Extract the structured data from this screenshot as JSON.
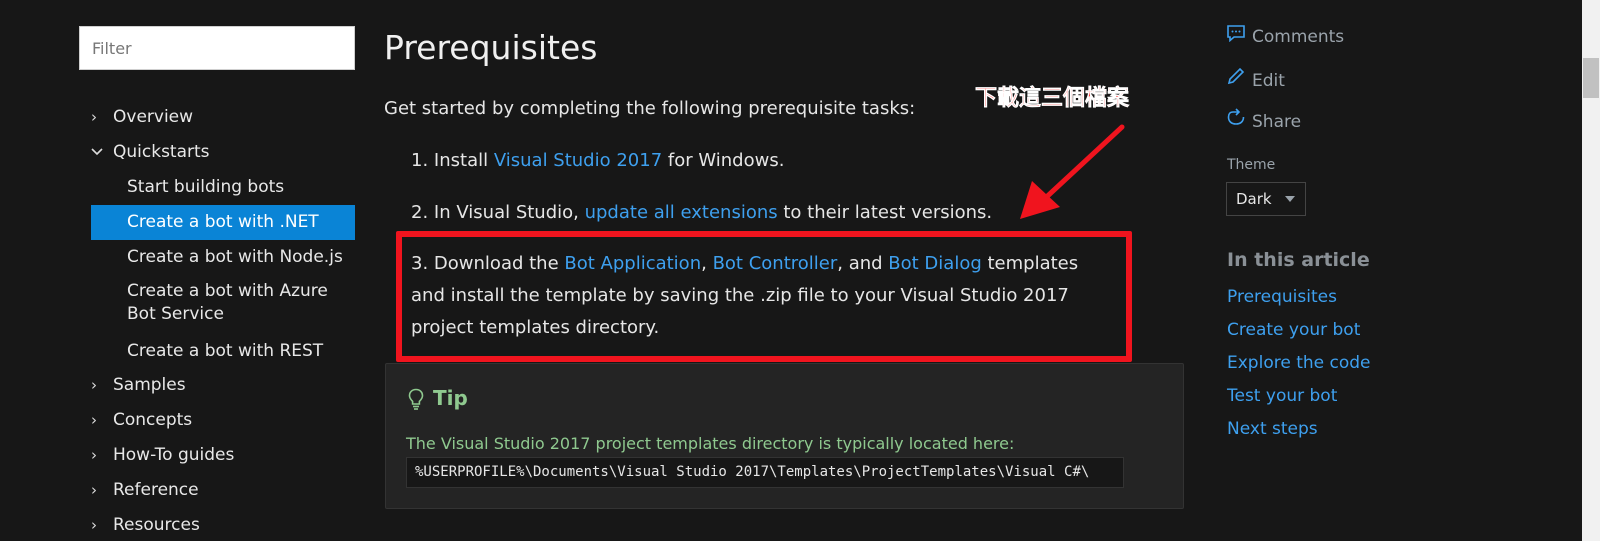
{
  "nav": {
    "filter_placeholder": "Filter",
    "items": [
      {
        "label": "Overview",
        "expanded": false
      },
      {
        "label": "Quickstarts",
        "expanded": true
      },
      {
        "label": "Samples",
        "expanded": false
      },
      {
        "label": "Concepts",
        "expanded": false
      },
      {
        "label": "How-To guides",
        "expanded": false
      },
      {
        "label": "Reference",
        "expanded": false
      },
      {
        "label": "Resources",
        "expanded": false
      }
    ],
    "quickstarts": [
      "Start building bots",
      "Create a bot with .NET",
      "Create a bot with Node.js",
      "Create a bot with Azure Bot Service",
      "Create a bot with REST"
    ],
    "active_item": "Create a bot with .NET"
  },
  "main": {
    "title": "Prerequisites",
    "intro": "Get started by completing the following prerequisite tasks:",
    "step1": {
      "num": "1.",
      "pre": "Install ",
      "link": "Visual Studio 2017",
      "post": " for Windows."
    },
    "step2": {
      "num": "2.",
      "pre": "In Visual Studio, ",
      "link": "update all extensions",
      "post": " to their latest versions."
    },
    "step3": {
      "num": "3.",
      "pre": "Download the ",
      "link1": "Bot Application",
      "sep1": ", ",
      "link2": "Bot Controller",
      "sep2": ", and ",
      "link3": "Bot Dialog",
      "post": " templates and install the template by saving the .zip file to your Visual Studio 2017 project templates directory."
    },
    "annotation": "下載這三個檔案",
    "tip": {
      "title": "Tip",
      "text": "The Visual Studio 2017 project templates directory is typically located here:",
      "code": "%USERPROFILE%\\Documents\\Visual Studio 2017\\Templates\\ProjectTemplates\\Visual C#\\"
    }
  },
  "sidebar": {
    "actions": [
      {
        "label": "Comments",
        "icon": "comment-icon"
      },
      {
        "label": "Edit",
        "icon": "pencil-icon"
      },
      {
        "label": "Share",
        "icon": "share-icon"
      }
    ],
    "theme_label": "Theme",
    "theme_value": "Dark",
    "toc_title": "In this article",
    "toc": [
      "Prerequisites",
      "Create your bot",
      "Explore the code",
      "Test your bot",
      "Next steps"
    ]
  },
  "colors": {
    "background": "#171717",
    "accent": "#0a84d6",
    "link": "#3ea0ef",
    "highlight_box": "#f0141e",
    "tip_text": "#8fc98f"
  }
}
